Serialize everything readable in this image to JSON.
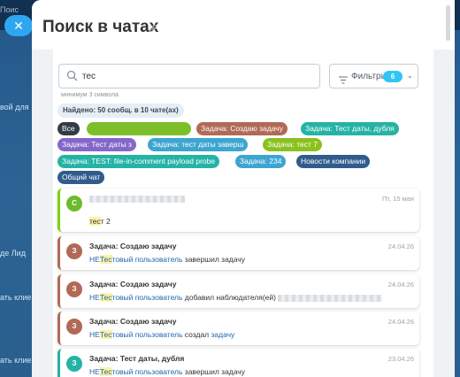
{
  "background": {
    "search_text": "Поис",
    "labels": [
      {
        "text": "вой для"
      },
      {
        "text": "де Лид"
      },
      {
        "text": "ать клиен"
      },
      {
        "text": "ать клиен"
      }
    ]
  },
  "panel": {
    "title": "Поиск в чатах",
    "search": {
      "value": "тес",
      "hint": "минимум 3 символа"
    },
    "filters": {
      "label": "Фильтры",
      "count": "6"
    },
    "found": "Найдено: 50 сообщ. в 10 чате(ах)",
    "chips": [
      {
        "label": "Все",
        "color": "#333b45"
      },
      {
        "label": "",
        "color": "#7cbf2a"
      },
      {
        "label": "Задача: Создаю задачу",
        "color": "#b06a55"
      },
      {
        "label": "Задача: Тест даты, дубля",
        "color": "#25b3a5"
      },
      {
        "label": "Задача: Тест даты з",
        "color": "#8467c9"
      },
      {
        "label": "Задача: тест даты заверш",
        "color": "#3da5d1"
      },
      {
        "label": "Задача: тест 7",
        "color": "#8bc11d"
      },
      {
        "label": "Задача: TEST: file-in-comment payload probe",
        "color": "#25b3a5"
      },
      {
        "label": "Задача: 234",
        "color": "#3da5d1"
      },
      {
        "label": "Новости компании",
        "color": "#2f5c8c"
      },
      {
        "label": "Общий чат",
        "color": "#2f5c8c"
      }
    ],
    "results": [
      {
        "avatar": "С",
        "avatar_color": "#6cbb2b",
        "accent": "#7bd500",
        "title": "",
        "date": "Пт, 15 мая",
        "pre": "",
        "hl": "тес",
        "post": "т 2",
        "text": ""
      },
      {
        "avatar": "З",
        "avatar_color": "#b06a55",
        "accent": "#b06a55",
        "title": "Задача: Создаю задачу",
        "date": "24.04.26",
        "pre": "НЕ",
        "hl": "Тес",
        "post": "товый пользователь",
        "text": " завершил задачу"
      },
      {
        "avatar": "З",
        "avatar_color": "#b06a55",
        "accent": "#b06a55",
        "title": "Задача: Создаю задачу",
        "date": "24.04.26",
        "pre": "НЕ",
        "hl": "Тес",
        "post": "товый пользователь",
        "text": " добавил наблюдателя(ей)"
      },
      {
        "avatar": "З",
        "avatar_color": "#b06a55",
        "accent": "#b06a55",
        "title": "Задача: Создаю задачу",
        "date": "24.04.26",
        "pre": "НЕ",
        "hl": "Тес",
        "post": "товый пользователь",
        "text": " создал ",
        "link": "задачу"
      },
      {
        "avatar": "З",
        "avatar_color": "#25b3a5",
        "accent": "#25b3a5",
        "title": "Задача: Тест даты, дубля",
        "date": "23.04.26",
        "pre": "НЕ",
        "hl": "Тес",
        "post": "товый пользователь",
        "text": " завершил задачу"
      }
    ]
  }
}
